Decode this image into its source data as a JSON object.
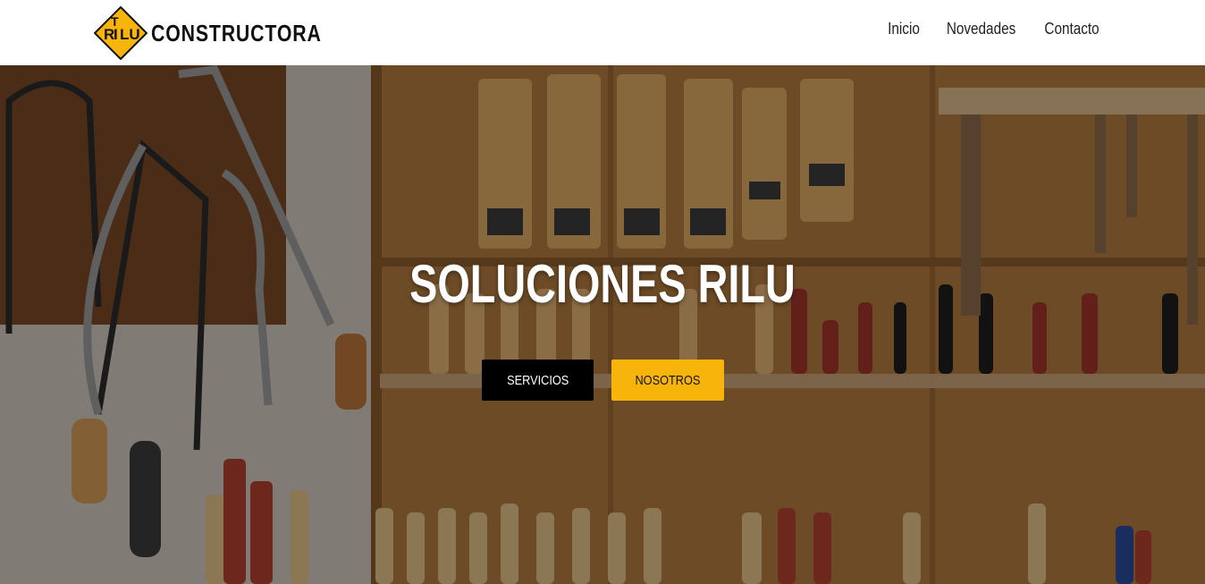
{
  "brand": {
    "logo_badge": "RILU",
    "name": "CONSTRUCTORA",
    "badge_color": "#f7b40a"
  },
  "nav": {
    "items": [
      {
        "label": "Inicio"
      },
      {
        "label": "Novedades"
      },
      {
        "label": "Contacto"
      }
    ]
  },
  "hero": {
    "title": "SOLUCIONES RILU",
    "buttons": {
      "services_label": "SERVICIOS",
      "about_label": "NOSOTROS"
    },
    "background": "workshop-tools-photo"
  },
  "colors": {
    "accent": "#f7b40a",
    "dark": "#000000"
  }
}
